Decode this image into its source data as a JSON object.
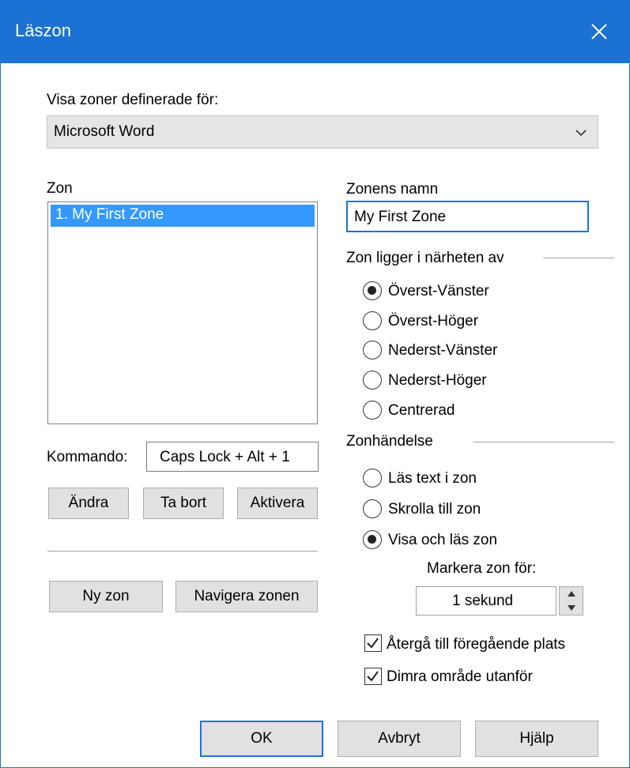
{
  "window": {
    "title": "Läszon"
  },
  "view_for": {
    "label": "Visa zoner definerade för:",
    "value": "Microsoft Word"
  },
  "zone_list": {
    "label": "Zon",
    "items": [
      "1. My First Zone"
    ]
  },
  "zone_name": {
    "label": "Zonens namn",
    "value": "My First Zone"
  },
  "proximity": {
    "label": "Zon ligger i närheten av",
    "options": [
      "Överst-Vänster",
      "Överst-Höger",
      "Nederst-Vänster",
      "Nederst-Höger",
      "Centrerad"
    ],
    "selected": "Överst-Vänster"
  },
  "command": {
    "label": "Kommando:",
    "value": "Caps Lock + Alt + 1"
  },
  "buttons": {
    "change": "Ändra",
    "delete": "Ta bort",
    "activate": "Aktivera",
    "new_zone": "Ny zon",
    "navigate": "Navigera zonen",
    "ok": "OK",
    "cancel": "Avbryt",
    "help": "Hjälp"
  },
  "zone_event": {
    "label": "Zonhändelse",
    "options": [
      "Läs text i zon",
      "Skrolla till zon",
      "Visa och läs zon"
    ],
    "selected": "Visa och läs zon"
  },
  "highlight": {
    "label": "Markera zon för:",
    "value": "1 sekund"
  },
  "checkboxes": [
    {
      "label": "Återgå till föregående plats",
      "checked": true
    },
    {
      "label": "Dimra område utanför",
      "checked": true
    }
  ]
}
